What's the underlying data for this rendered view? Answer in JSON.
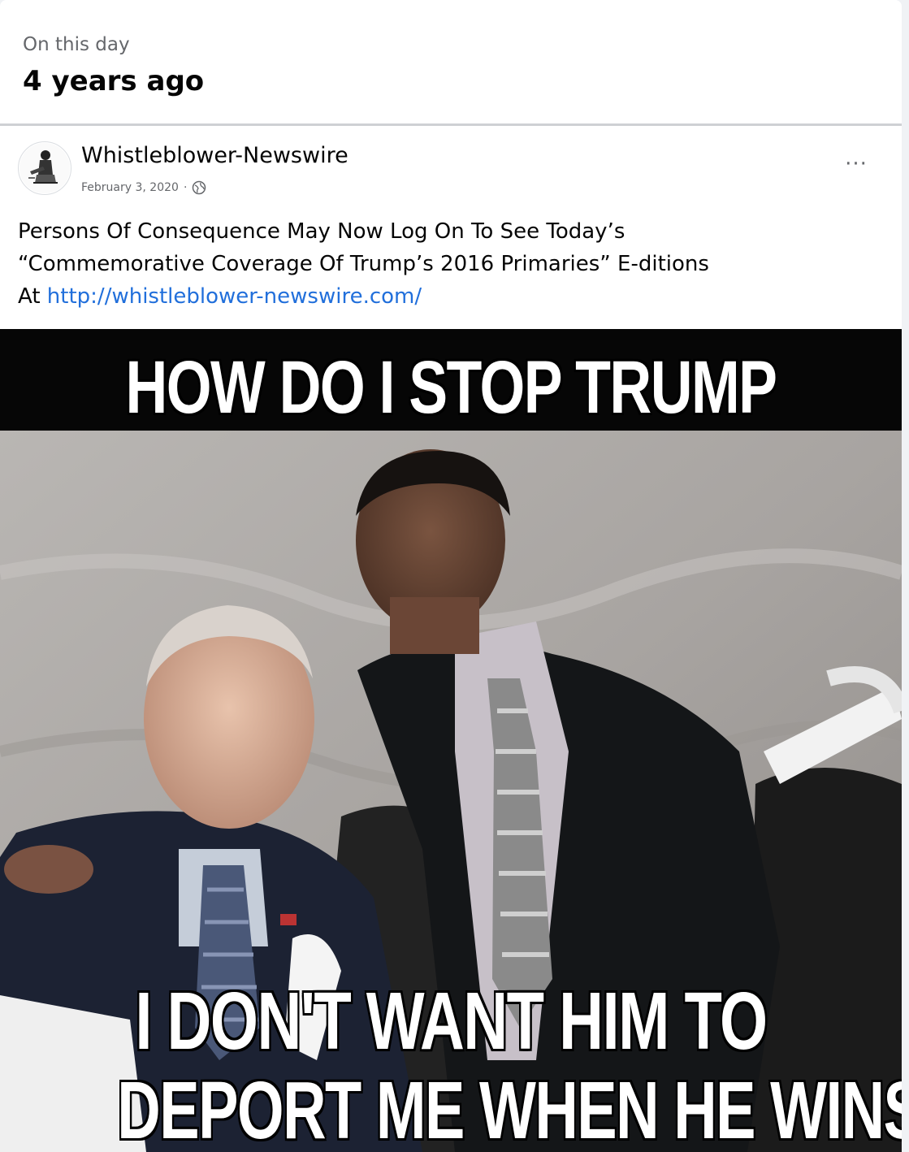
{
  "memory": {
    "subtitle": "On this day",
    "title": "4 years ago"
  },
  "post": {
    "author": "Whistleblower-Newswire",
    "date": "February 3, 2020",
    "separator": "·",
    "privacy_icon": "globe-icon",
    "more_icon": "more-options-icon",
    "more_label": "···",
    "text_line1": "Persons Of Consequence May Now Log On To See Today’s",
    "text_line2": "“Commemorative Coverage Of Trump’s 2016 Primaries” E-ditions",
    "text_line3_prefix": "At ",
    "link": "http://whistleblower-newswire.com/"
  },
  "image": {
    "caption_top": "HOW DO I STOP TRUMP",
    "caption_bottom_line1": "I DON'T WANT HIM TO",
    "caption_bottom_line2": "DEPORT ME WHEN HE WINS"
  },
  "colors": {
    "link": "#216fdb",
    "muted_text": "#65676b",
    "divider": "#ced0d4"
  }
}
